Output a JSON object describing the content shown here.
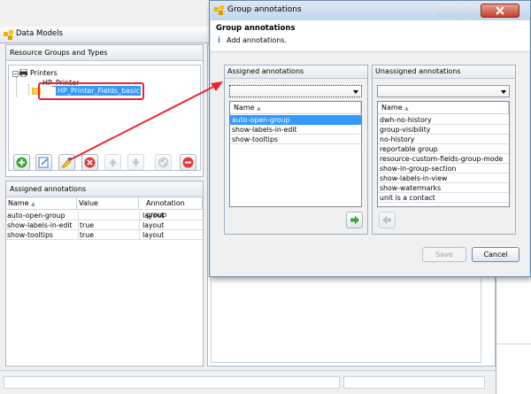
{
  "main": {
    "title": "Data Models",
    "resource_panel": {
      "title": "Resource Groups and Types",
      "tree": [
        "Printers",
        "HP_Printer",
        "HP_Printer_Fields_basic"
      ]
    },
    "assigned_panel": {
      "title": "Assigned annotations",
      "columns": [
        "Name",
        "Value",
        "Annotation group"
      ],
      "rows": [
        {
          "name": "auto-open-group",
          "value": "",
          "group": "layout"
        },
        {
          "name": "show-labels-in-edit",
          "value": "true",
          "group": "layout"
        },
        {
          "name": "show-tooltips",
          "value": "true",
          "group": "layout"
        }
      ]
    }
  },
  "dialog": {
    "title": "Group annotations",
    "heading": "Group annotations",
    "subheading": "Add annotations.",
    "assigned": {
      "title": "Assigned annotations",
      "column": "Name",
      "items": [
        "auto-open-group",
        "show-labels-in-edit",
        "show-tooltips"
      ]
    },
    "unassigned": {
      "title": "Unassigned annotations",
      "column": "Name",
      "items": [
        "dwh-no-history",
        "group-visibility",
        "no-history",
        "reportable group",
        "resource-custom-fields-group-mode",
        "show-in-group-section",
        "show-labels-in-view",
        "show-watermarks",
        "unit is a contact"
      ]
    },
    "save_label": "Save",
    "cancel_label": "Cancel"
  },
  "colors": {
    "selection": "#3399ff",
    "highlight": "#e8262d",
    "accent": "#3b7fc4"
  }
}
